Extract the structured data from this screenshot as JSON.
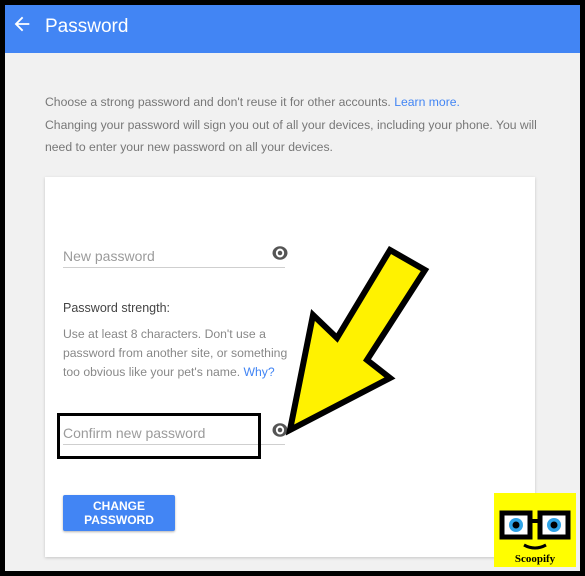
{
  "header": {
    "title": "Password",
    "back_icon": "arrow-back-icon",
    "bar_color": "#4285f4"
  },
  "intro": {
    "line1": "Choose a strong password and don't reuse it for other accounts.",
    "learn_more": "Learn more.",
    "line2": "Changing your password will sign you out of all your devices, including your phone. You will need to enter your new password on all your devices."
  },
  "form": {
    "new_password_placeholder": "New password",
    "new_password_value": "",
    "strength_label": "Password strength:",
    "strength_help": "Use at least 8 characters. Don't use a password from another site, or something too obvious like your pet's name.",
    "why_link": "Why?",
    "confirm_password_placeholder": "Confirm new password",
    "confirm_password_value": "",
    "show_password_icon": "eye-icon",
    "submit_label": "CHANGE PASSWORD"
  },
  "overlay": {
    "arrow_color": "#fff200",
    "logo_text": "Scoopify"
  }
}
